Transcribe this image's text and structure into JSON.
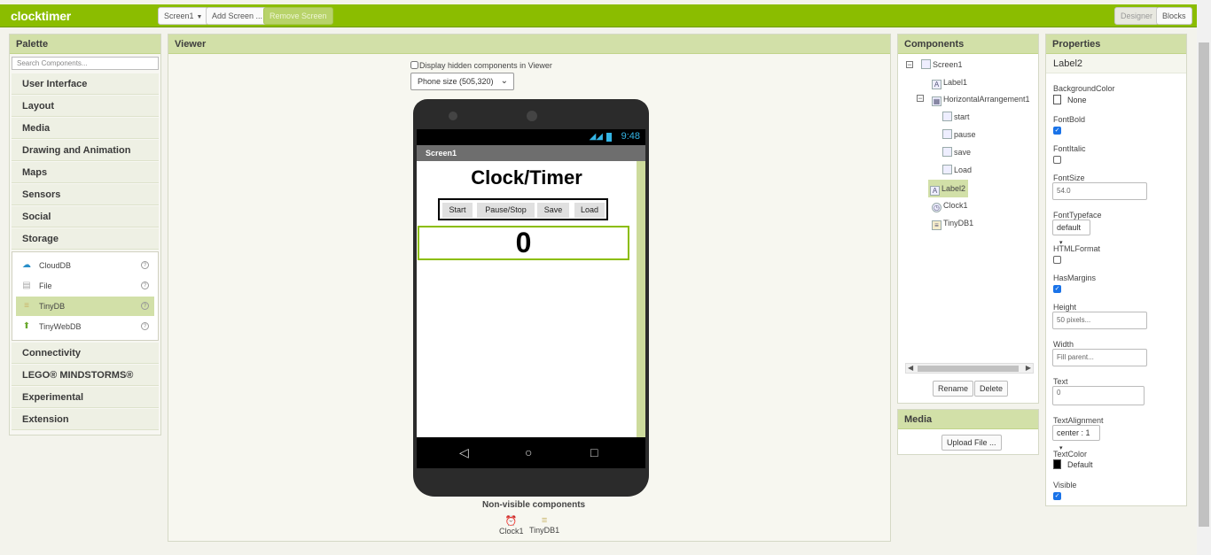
{
  "app": {
    "title": "clocktimer"
  },
  "toolbar": {
    "screen_select": "Screen1",
    "add_screen": "Add Screen ...",
    "remove_screen": "Remove Screen",
    "designer": "Designer",
    "blocks": "Blocks"
  },
  "palette": {
    "title": "Palette",
    "search_placeholder": "Search Components...",
    "categories": [
      "User Interface",
      "Layout",
      "Media",
      "Drawing and Animation",
      "Maps",
      "Sensors",
      "Social",
      "Storage"
    ],
    "storage_items": [
      {
        "label": "CloudDB",
        "icon": "cloud-icon"
      },
      {
        "label": "File",
        "icon": "file-icon"
      },
      {
        "label": "TinyDB",
        "icon": "database-icon",
        "selected": true
      },
      {
        "label": "TinyWebDB",
        "icon": "web-database-icon"
      }
    ],
    "categories_after": [
      "Connectivity",
      "LEGO® MINDSTORMS®",
      "Experimental",
      "Extension"
    ]
  },
  "viewer": {
    "title": "Viewer",
    "hidden_components_label": "Display hidden components in Viewer",
    "phone_size": "Phone size (505,320)",
    "status_time": "9:48",
    "screen_title": "Screen1",
    "label1": "Clock/Timer",
    "buttons": [
      "Start",
      "Pause/Stop",
      "Save",
      "Load"
    ],
    "label2": "0",
    "nonvisible_title": "Non-visible components",
    "nonvisible": [
      "Clock1",
      "TinyDB1"
    ]
  },
  "components": {
    "title": "Components",
    "tree": [
      {
        "label": "Screen1",
        "level": 0
      },
      {
        "label": "Label1",
        "level": 1
      },
      {
        "label": "HorizontalArrangement1",
        "level": 1
      },
      {
        "label": "start",
        "level": 2
      },
      {
        "label": "pause",
        "level": 2
      },
      {
        "label": "save",
        "level": 2
      },
      {
        "label": "Load",
        "level": 2
      },
      {
        "label": "Label2",
        "level": 1,
        "selected": true
      },
      {
        "label": "Clock1",
        "level": 1
      },
      {
        "label": "TinyDB1",
        "level": 1
      }
    ],
    "rename": "Rename",
    "delete": "Delete"
  },
  "media": {
    "title": "Media",
    "upload": "Upload File ..."
  },
  "properties": {
    "title": "Properties",
    "component": "Label2",
    "background_color_label": "BackgroundColor",
    "background_color_value": "None",
    "font_bold_label": "FontBold",
    "font_italic_label": "FontItalic",
    "font_size_label": "FontSize",
    "font_size_value": "54.0",
    "font_typeface_label": "FontTypeface",
    "font_typeface_value": "default",
    "html_format_label": "HTMLFormat",
    "has_margins_label": "HasMargins",
    "height_label": "Height",
    "height_value": "50 pixels...",
    "width_label": "Width",
    "width_value": "Fill parent...",
    "text_label": "Text",
    "text_value": "0",
    "text_alignment_label": "TextAlignment",
    "text_alignment_value": "center : 1",
    "text_color_label": "TextColor",
    "text_color_value": "Default",
    "visible_label": "Visible",
    "checks": {
      "font_bold": true,
      "font_italic": false,
      "html_format": false,
      "has_margins": true,
      "visible": true
    }
  },
  "colors": {
    "accent": "#8bbd00",
    "panel_header": "#d2e0a8",
    "status_blue": "#34b5e5"
  }
}
